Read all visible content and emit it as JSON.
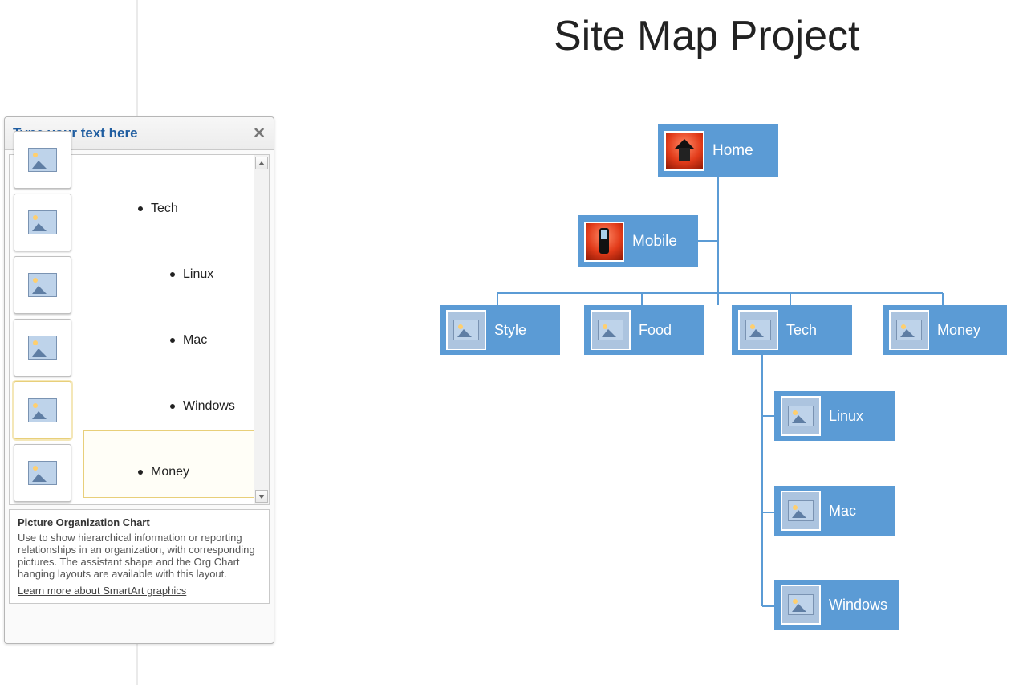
{
  "slide": {
    "title": "Site Map Project"
  },
  "textpane": {
    "title": "Type your text here",
    "bullets": [
      {
        "label": "Tech",
        "level": 1
      },
      {
        "label": "Linux",
        "level": 2
      },
      {
        "label": "Mac",
        "level": 2
      },
      {
        "label": "Windows",
        "level": 2
      },
      {
        "label": "Money",
        "level": 1
      }
    ],
    "selected_index": 3,
    "desc_title": "Picture Organization Chart",
    "desc_body": "Use to show hierarchical information or reporting relationships in an organization, with corresponding pictures. The assistant shape and the Org Chart hanging layouts are available with this layout.",
    "link": "Learn more about SmartArt graphics"
  },
  "orgchart": {
    "home": "Home",
    "mobile": "Mobile",
    "row": [
      "Style",
      "Food",
      "Tech",
      "Money"
    ],
    "techchildren": [
      "Linux",
      "Mac",
      "Windows"
    ]
  },
  "colors": {
    "accent": "#5b9bd5"
  }
}
